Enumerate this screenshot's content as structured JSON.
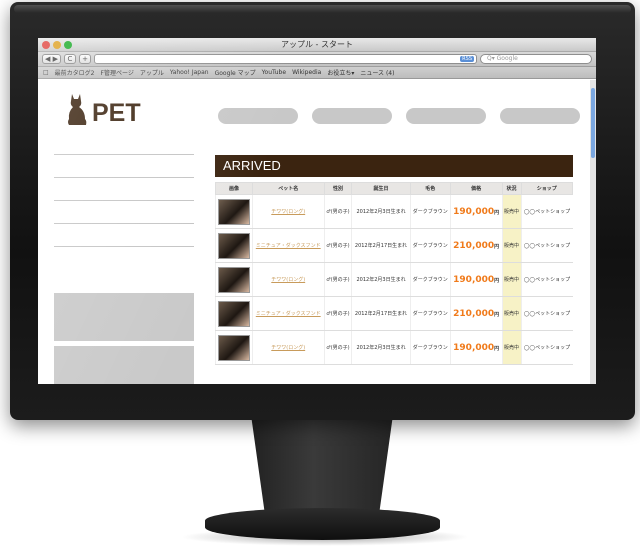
{
  "window": {
    "title": "アップル - スタート"
  },
  "toolbar": {
    "back": "◀ ▶",
    "reload": "C",
    "add": "+",
    "search_placeholder": "Q▾ Google",
    "rss": "RSS"
  },
  "bookmarks": [
    "□",
    "最前カタログ2",
    "F管理ページ",
    "アップル",
    "Yahoo! Japan",
    "Google マップ",
    "YouTube",
    "Wikipedia",
    "お役立ち▾",
    "ニュース (4)"
  ],
  "site": {
    "logo": "PET",
    "section_title": "ARRIVED"
  },
  "table": {
    "headers": [
      "画像",
      "ペット名",
      "性別",
      "誕生日",
      "毛色",
      "価格",
      "状況",
      "ショップ"
    ],
    "rows": [
      {
        "name": "チワワ(ロング)",
        "sex": "♂(男の子)",
        "birth": "2012年2月3日生まれ",
        "color": "ダークブラウン",
        "price": "190,000",
        "yen": "円",
        "status": "販売中",
        "shop": "◯◯ペットショップ"
      },
      {
        "name": "ミニチュア・ダックスフンド",
        "sex": "♂(男の子)",
        "birth": "2012年2月17日生まれ",
        "color": "ダークブラウン",
        "price": "210,000",
        "yen": "円",
        "status": "販売中",
        "shop": "◯◯ペットショップ"
      },
      {
        "name": "チワワ(ロング)",
        "sex": "♂(男の子)",
        "birth": "2012年2月3日生まれ",
        "color": "ダークブラウン",
        "price": "190,000",
        "yen": "円",
        "status": "販売中",
        "shop": "◯◯ペットショップ"
      },
      {
        "name": "ミニチュア・ダックスフンド",
        "sex": "♂(男の子)",
        "birth": "2012年2月17日生まれ",
        "color": "ダークブラウン",
        "price": "210,000",
        "yen": "円",
        "status": "販売中",
        "shop": "◯◯ペットショップ"
      },
      {
        "name": "チワワ(ロング)",
        "sex": "♂(男の子)",
        "birth": "2012年2月3日生まれ",
        "color": "ダークブラウン",
        "price": "190,000",
        "yen": "円",
        "status": "販売中",
        "shop": "◯◯ペットショップ"
      }
    ]
  },
  "colors": {
    "brand": "#3b2410",
    "price": "#f07a1a",
    "status_bg": "#f7f2c6"
  }
}
